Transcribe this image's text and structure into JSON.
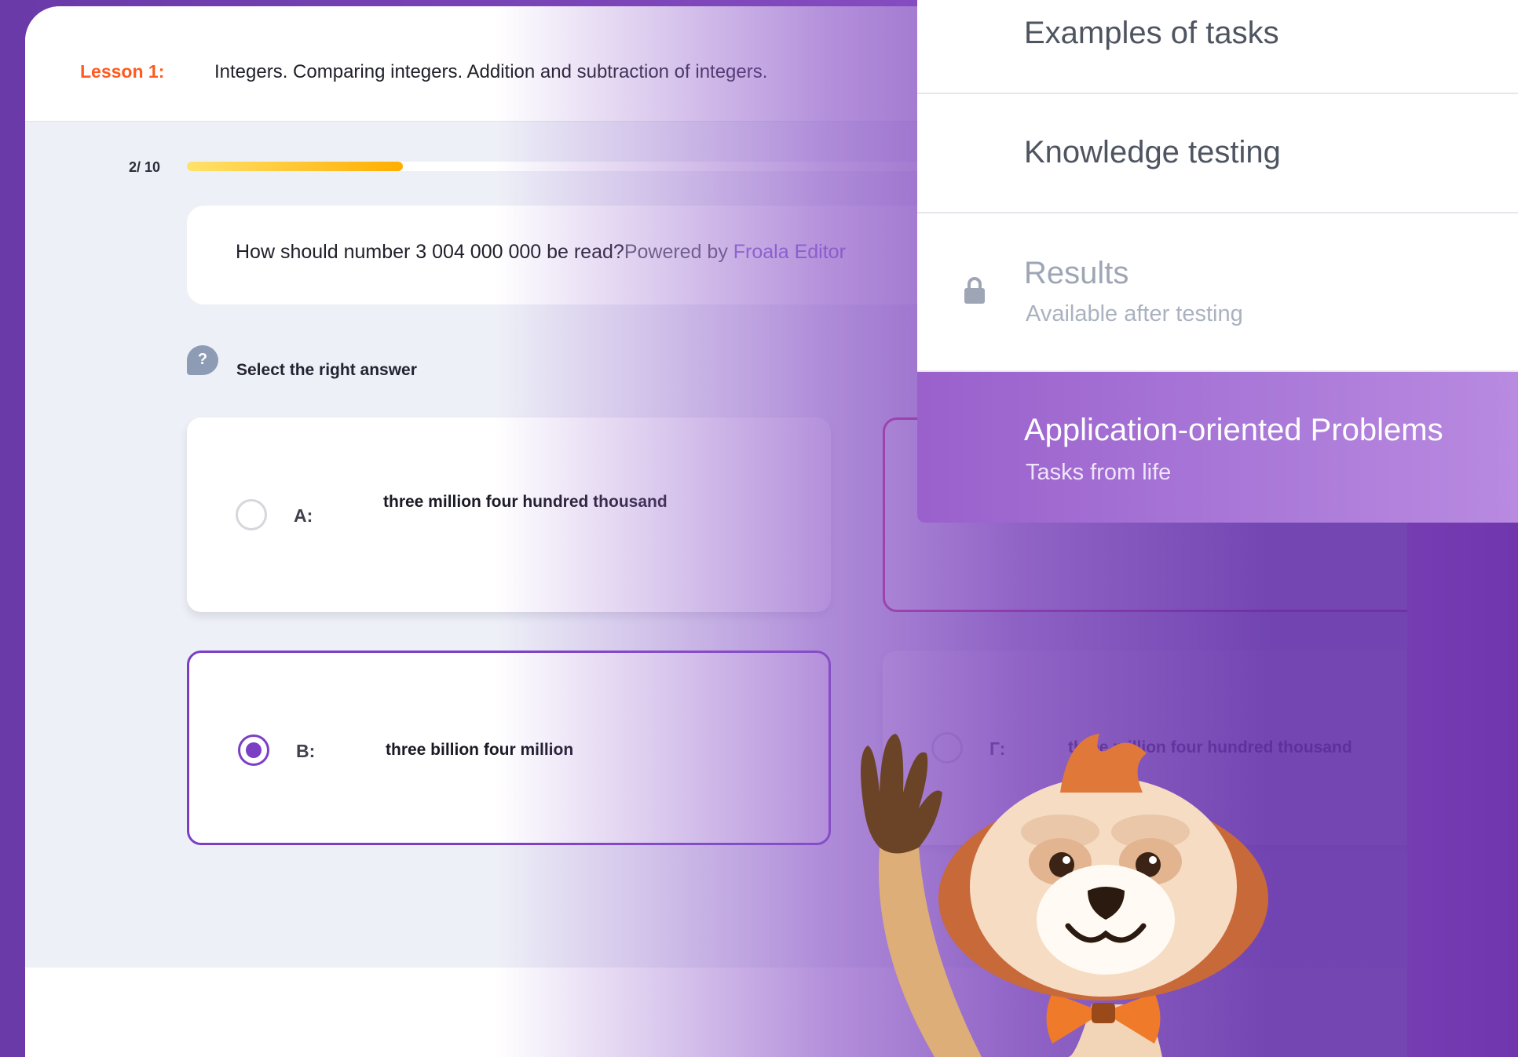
{
  "lesson": {
    "label": "Lesson 1:",
    "title": "Integers. Comparing integers. Addition and subtraction of integers."
  },
  "progress": {
    "label": "2/ 10",
    "current": 2,
    "total": 10,
    "fill_fraction": 0.25
  },
  "question": {
    "text": "How should number 3 004 000 000 be read?",
    "powered_by": "Powered by ",
    "editor_name": "Froala Editor"
  },
  "hint": {
    "icon": "question-bubble-icon",
    "icon_glyph": "?",
    "text": "Select the right answer"
  },
  "options": [
    {
      "letter": "A:",
      "text": "three million four hundred thousand",
      "state": "default"
    },
    {
      "letter": "B:",
      "text": "three billion four million",
      "state": "selected"
    },
    {
      "letter": "Г:",
      "text": "three million four hundred thousand",
      "state": "default"
    }
  ],
  "menu": {
    "items": [
      {
        "title": "Examples of tasks",
        "subtitle": "",
        "state": "default"
      },
      {
        "title": "Knowledge testing",
        "subtitle": "",
        "state": "default"
      },
      {
        "title": "Results",
        "subtitle": "Available after testing",
        "state": "locked",
        "icon": "lock-icon"
      },
      {
        "title": "Application-oriented Problems",
        "subtitle": "Tasks from life",
        "state": "active"
      }
    ]
  },
  "colors": {
    "lesson_label": "#ff5a1f",
    "accent_purple": "#7b3fc4",
    "error_pink": "#d42a7c",
    "progress_start": "#ffe26b",
    "progress_end": "#ffae00"
  }
}
